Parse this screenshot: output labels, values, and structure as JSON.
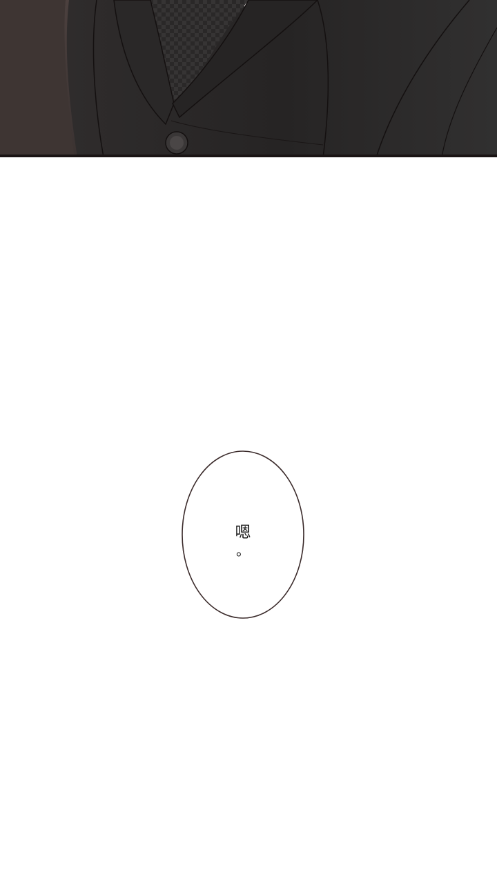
{
  "page": {
    "background_color": "#ffffff"
  },
  "top_panel": {
    "subject": "suit-jacket-closeup",
    "colors": {
      "jacket": "#2b2a2a",
      "jacket_shadow": "#1c1b1b",
      "background_left": "#4a3f3d",
      "tie": "#3a3838",
      "shirt": "#e9e4e4",
      "border": "#1a1414"
    }
  },
  "speech_bubble": {
    "text": "嗯",
    "punctuation": "。",
    "outline_color": "#3a2a2a"
  }
}
